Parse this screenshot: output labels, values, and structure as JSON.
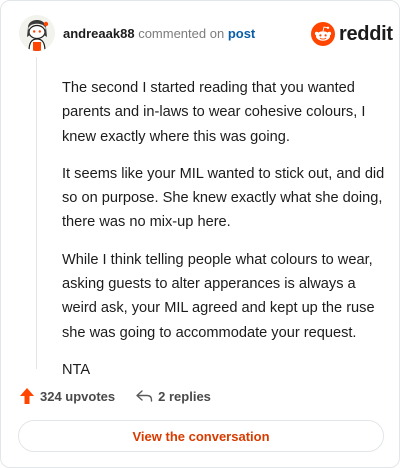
{
  "header": {
    "author": "andreaak88",
    "action_text": "commented on",
    "post_link": "post",
    "brand": "reddit",
    "avatar_icon": "snoo-avatar-icon",
    "logo_icon": "reddit-snoo-icon"
  },
  "comment": {
    "paragraphs": [
      "The second I started reading that you wanted parents and in-laws to wear cohesive colours, I knew exactly where this was going.",
      "It seems like your MIL wanted to stick out, and did so on purpose. She knew exactly what she doing, there was no mix-up here.",
      "While I think telling people what colours to wear, asking guests to alter apperances is always a weird ask, your MIL agreed and kept up the ruse she was going to accommodate your request.",
      "NTA"
    ]
  },
  "footer": {
    "upvotes": "324 upvotes",
    "replies": "2 replies",
    "upvote_icon": "upvote-arrow-icon",
    "reply_icon": "reply-arrow-icon",
    "view_button": "View the conversation"
  },
  "colors": {
    "brand_orange": "#ff4500",
    "link_blue": "#0a5ea8",
    "button_text": "#d93a00"
  }
}
